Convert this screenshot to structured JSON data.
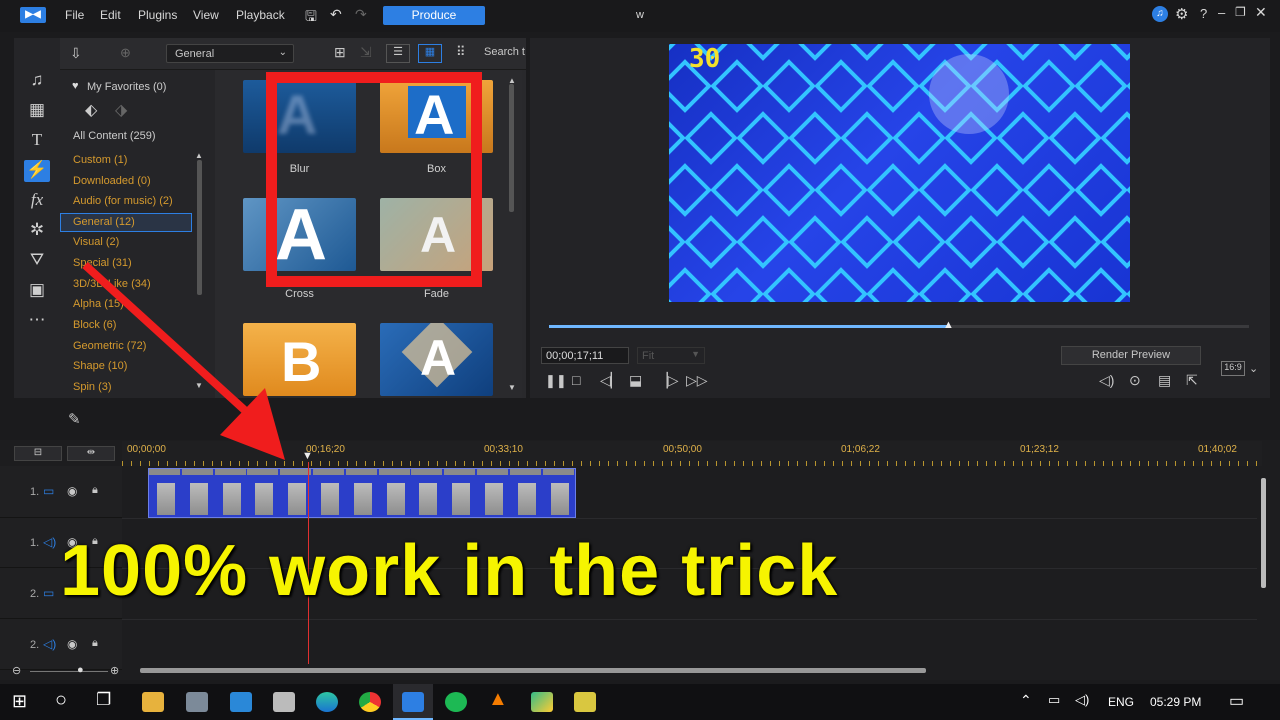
{
  "menubar": {
    "items": [
      "File",
      "Edit",
      "Plugins",
      "View",
      "Playback"
    ],
    "produce": "Produce",
    "title": "w"
  },
  "library": {
    "dropdown": "General",
    "search_placeholder": "Search t",
    "favorites": "My Favorites (0)",
    "all_content": "All Content (259)",
    "categories": [
      {
        "label": "Custom  (1)"
      },
      {
        "label": "Downloaded  (0)"
      },
      {
        "label": "Audio (for music)  (2)"
      },
      {
        "label": "General  (12)"
      },
      {
        "label": "Visual  (2)"
      },
      {
        "label": "Special  (31)"
      },
      {
        "label": "3D/3D-Like  (34)"
      },
      {
        "label": "Alpha  (15)"
      },
      {
        "label": "Block  (6)"
      },
      {
        "label": "Geometric  (72)"
      },
      {
        "label": "Shape  (10)"
      },
      {
        "label": "Spin  (3)"
      }
    ],
    "thumbs": [
      {
        "label": "Blur",
        "glyph": "A"
      },
      {
        "label": "Box",
        "glyph": "A"
      },
      {
        "label": "Cross",
        "glyph": "A"
      },
      {
        "label": "Fade",
        "glyph": "A"
      },
      {
        "label": "",
        "glyph": "B"
      },
      {
        "label": "",
        "glyph": "A"
      }
    ]
  },
  "preview": {
    "overlay_text": "30",
    "progress": 0.57,
    "timecode": "00;00;17;11",
    "fit": "Fit",
    "render": "Render Preview",
    "aspect": "16:9"
  },
  "timeline": {
    "ticks": [
      "00;00;00",
      "00;16;20",
      "00;33;10",
      "00;50;00",
      "01;06;22",
      "01;23;12",
      "01;40;02"
    ],
    "tracks": [
      {
        "num": "1."
      },
      {
        "num": "1."
      },
      {
        "num": "2."
      },
      {
        "num": "2."
      }
    ]
  },
  "overlay": "100% work in the trick",
  "taskbar": {
    "lang": "ENG",
    "time": "05:29 PM"
  }
}
